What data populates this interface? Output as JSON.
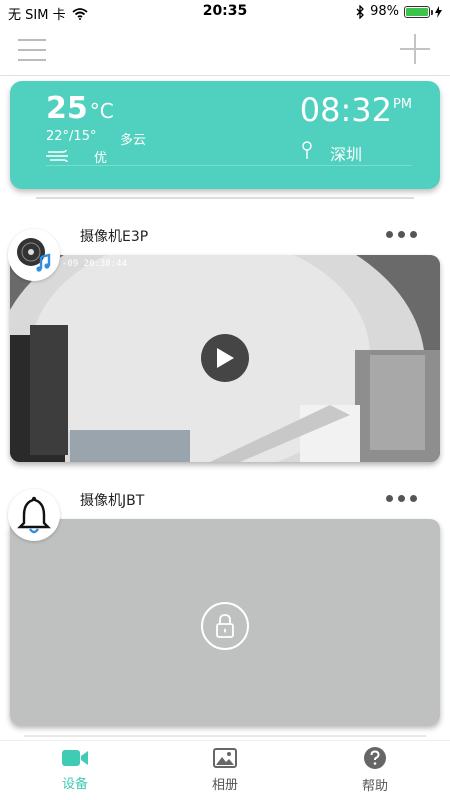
{
  "status_bar": {
    "carrier": "无 SIM 卡",
    "time": "20:35",
    "battery": "98%",
    "battery_level": 0.98
  },
  "weather": {
    "temp": "25",
    "unit": "°C",
    "range": "22°/15°",
    "condition": "多云",
    "air_quality": "优",
    "time": "08:32",
    "ampm": "PM",
    "city": "深圳",
    "color": "#50d0bf"
  },
  "cameras": [
    {
      "name": "摄像机E3P",
      "avatar_icon": "music-disc-icon",
      "timestamp": "-09 20:38:44",
      "state": "playable"
    },
    {
      "name": "摄像机JBT",
      "avatar_icon": "bell-icon",
      "state": "locked"
    }
  ],
  "tabs": [
    {
      "label": "设备",
      "icon": "video-camera-icon",
      "active": true,
      "color": "#3fcbb4"
    },
    {
      "label": "相册",
      "icon": "image-icon",
      "active": false
    },
    {
      "label": "帮助",
      "icon": "help-icon",
      "active": false
    }
  ]
}
